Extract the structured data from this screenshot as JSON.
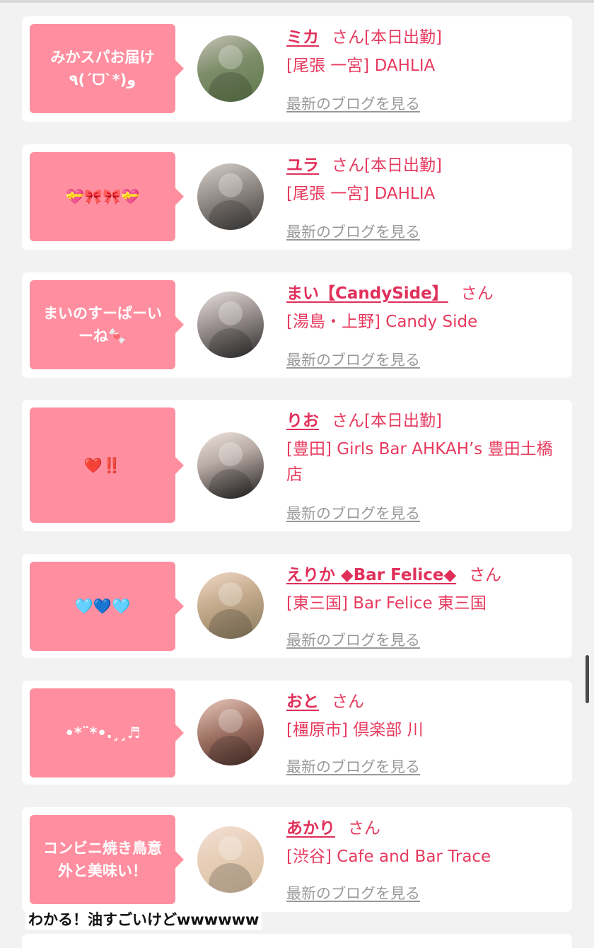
{
  "entries": [
    {
      "bubble": "みかスパお届け ٩(ˊᗜˋ*)و",
      "name": "ミカ",
      "suffix": "さん[本日出勤]",
      "shop": "[尾張 一宮] DAHLIA",
      "blog": "最新のブログを見る",
      "avatar_colors": [
        "#5e7a4a",
        "#c9c3b8"
      ]
    },
    {
      "bubble": "💝🎀🎀💝",
      "name": "ユラ",
      "suffix": "さん[本日出勤]",
      "shop": "[尾張 一宮] DAHLIA",
      "blog": "最新のブログを見る",
      "avatar_colors": [
        "#3a3a3a",
        "#d8d2cc"
      ]
    },
    {
      "bubble": "まいのすーぱーいーね🍬",
      "name": "まい【CandySide】",
      "suffix": "さん",
      "shop": "[湯島・上野] Candy Side",
      "blog": "最新のブログを見る",
      "avatar_colors": [
        "#2b2b2b",
        "#e8e0e0"
      ]
    },
    {
      "bubble": "❤️‼️",
      "name": "りお",
      "suffix": "さん[本日出勤]",
      "shop": "[豊田] Girls Bar AHKAH’s 豊田土橋店",
      "blog": "最新のブログを見る",
      "avatar_colors": [
        "#1e1e1e",
        "#efe6e1"
      ]
    },
    {
      "bubble": "🩵💙🩵",
      "name": "えりか ◆Bar Felice◆",
      "suffix": "さん",
      "shop": "[東三国] Bar Felice 東三国",
      "blog": "最新のブログを見る",
      "avatar_colors": [
        "#8a7a5e",
        "#f1d9c8"
      ]
    },
    {
      "bubble": "•*¨*•.¸¸♬",
      "name": "おと",
      "suffix": "さん",
      "shop": "[橿原市] 倶楽部 川",
      "blog": "最新のブログを見る",
      "avatar_colors": [
        "#4a2f2a",
        "#e8c9bc"
      ]
    },
    {
      "bubble": "コンビニ焼き鳥意外と美味い！",
      "name": "あかり",
      "suffix": "さん",
      "shop": "[渋谷] Cafe and Bar Trace",
      "blog": "最新のブログを見る",
      "avatar_colors": [
        "#d8c0a2",
        "#f4e0d6"
      ]
    }
  ],
  "caption": "わかる！油すごいけどwwwwww"
}
